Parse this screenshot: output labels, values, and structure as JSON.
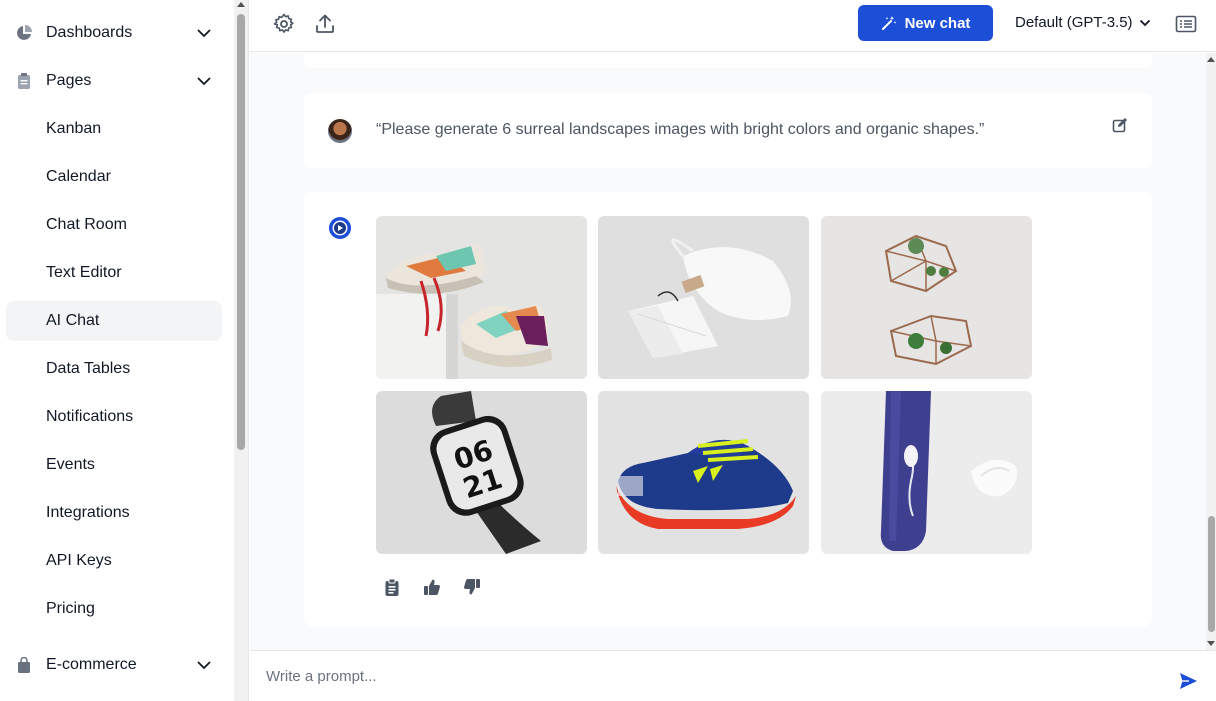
{
  "sidebar": {
    "items": [
      {
        "label": "Dashboards",
        "icon": "pie-chart-icon",
        "has_chevron": true
      },
      {
        "label": "Pages",
        "icon": "document-icon",
        "has_chevron": true
      },
      {
        "label": "Kanban"
      },
      {
        "label": "Calendar"
      },
      {
        "label": "Chat Room"
      },
      {
        "label": "Text Editor"
      },
      {
        "label": "AI Chat",
        "active": true
      },
      {
        "label": "Data Tables"
      },
      {
        "label": "Notifications"
      },
      {
        "label": "Events"
      },
      {
        "label": "Integrations"
      },
      {
        "label": "API Keys"
      },
      {
        "label": "Pricing"
      },
      {
        "label": "E-commerce",
        "icon": "shopping-bag-icon",
        "has_chevron": true
      }
    ]
  },
  "header": {
    "new_chat_label": "New chat",
    "model_label": "Default (GPT-3.5)",
    "accent_color": "#1d4ed8"
  },
  "conversation": {
    "user_prompt": "“Please generate 6 surreal landscapes images with bright colors and organic shapes.”",
    "images": [
      {
        "subject": "sneakers-on-block"
      },
      {
        "subject": "white-pouch-and-bag"
      },
      {
        "subject": "geometric-terrariums"
      },
      {
        "subject": "smartwatch"
      },
      {
        "subject": "blue-football-boot"
      },
      {
        "subject": "purple-cream-tube"
      }
    ],
    "watch_text_line1": "06",
    "watch_text_line2": "21"
  },
  "composer": {
    "placeholder": "Write a prompt..."
  }
}
